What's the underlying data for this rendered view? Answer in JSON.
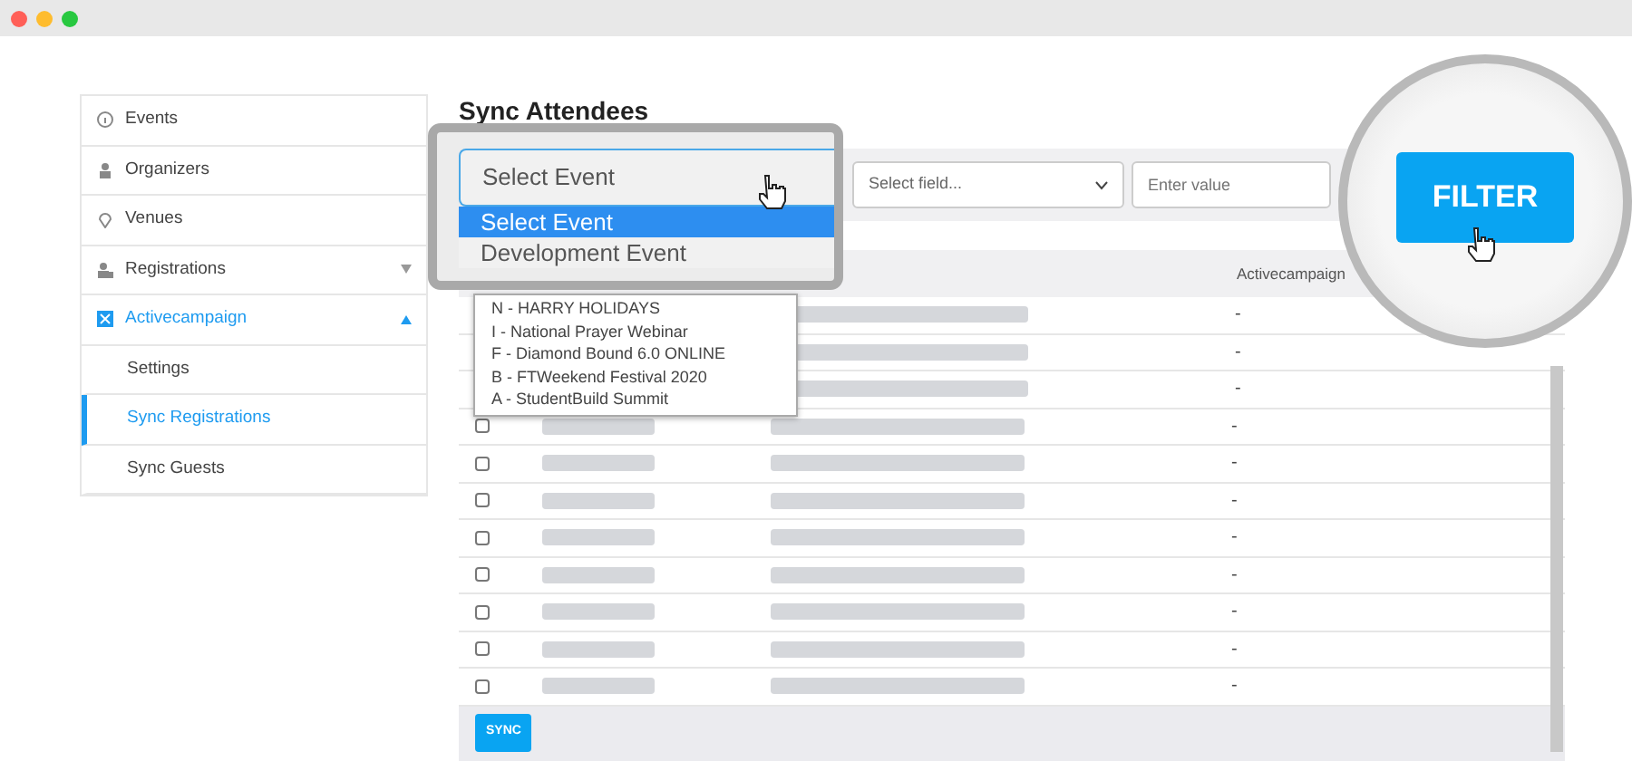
{
  "sidebar": {
    "items": [
      {
        "label": "Events",
        "selected": false
      },
      {
        "label": "Organizers",
        "selected": false
      },
      {
        "label": "Venues",
        "selected": false
      },
      {
        "label": "Registrations",
        "expanded": false,
        "selected": false
      },
      {
        "label": "Activecampaign",
        "expanded": true,
        "selected": true,
        "children": [
          {
            "label": "Settings",
            "selected": false
          },
          {
            "label": "Sync Registrations",
            "selected": true
          },
          {
            "label": "Sync Guests",
            "selected": false
          }
        ]
      }
    ]
  },
  "page_title": "Sync Attendees",
  "filters": {
    "field_select": {
      "placeholder": "Select field..."
    },
    "value_input": {
      "placeholder": "Enter value"
    },
    "filter_button": "FILTER"
  },
  "magnified_dropdown": {
    "value": "Select Event",
    "options": [
      {
        "label": "Select Event",
        "selected": true
      },
      {
        "label": "Development Event",
        "selected": false
      }
    ]
  },
  "event_options": [
    "N - HARRY HOLIDAYS",
    "I - National Prayer Webinar",
    "F - Diamond Bound 6.0 ONLINE",
    "B - FTWeekend Festival 2020",
    "A - StudentBuild Summit"
  ],
  "table": {
    "columns": [
      "Activecampaign"
    ],
    "rows": [
      {
        "status": "-"
      },
      {
        "status": "-"
      },
      {
        "status": "-"
      },
      {
        "checked": false,
        "status": "-"
      },
      {
        "checked": false,
        "status": "-"
      },
      {
        "checked": false,
        "status": "-"
      },
      {
        "checked": false,
        "status": "-"
      },
      {
        "checked": false,
        "status": "-"
      },
      {
        "checked": false,
        "status": "-"
      },
      {
        "checked": false,
        "status": "-"
      },
      {
        "checked": false,
        "status": "-"
      }
    ]
  },
  "sync_button": "SYNC"
}
